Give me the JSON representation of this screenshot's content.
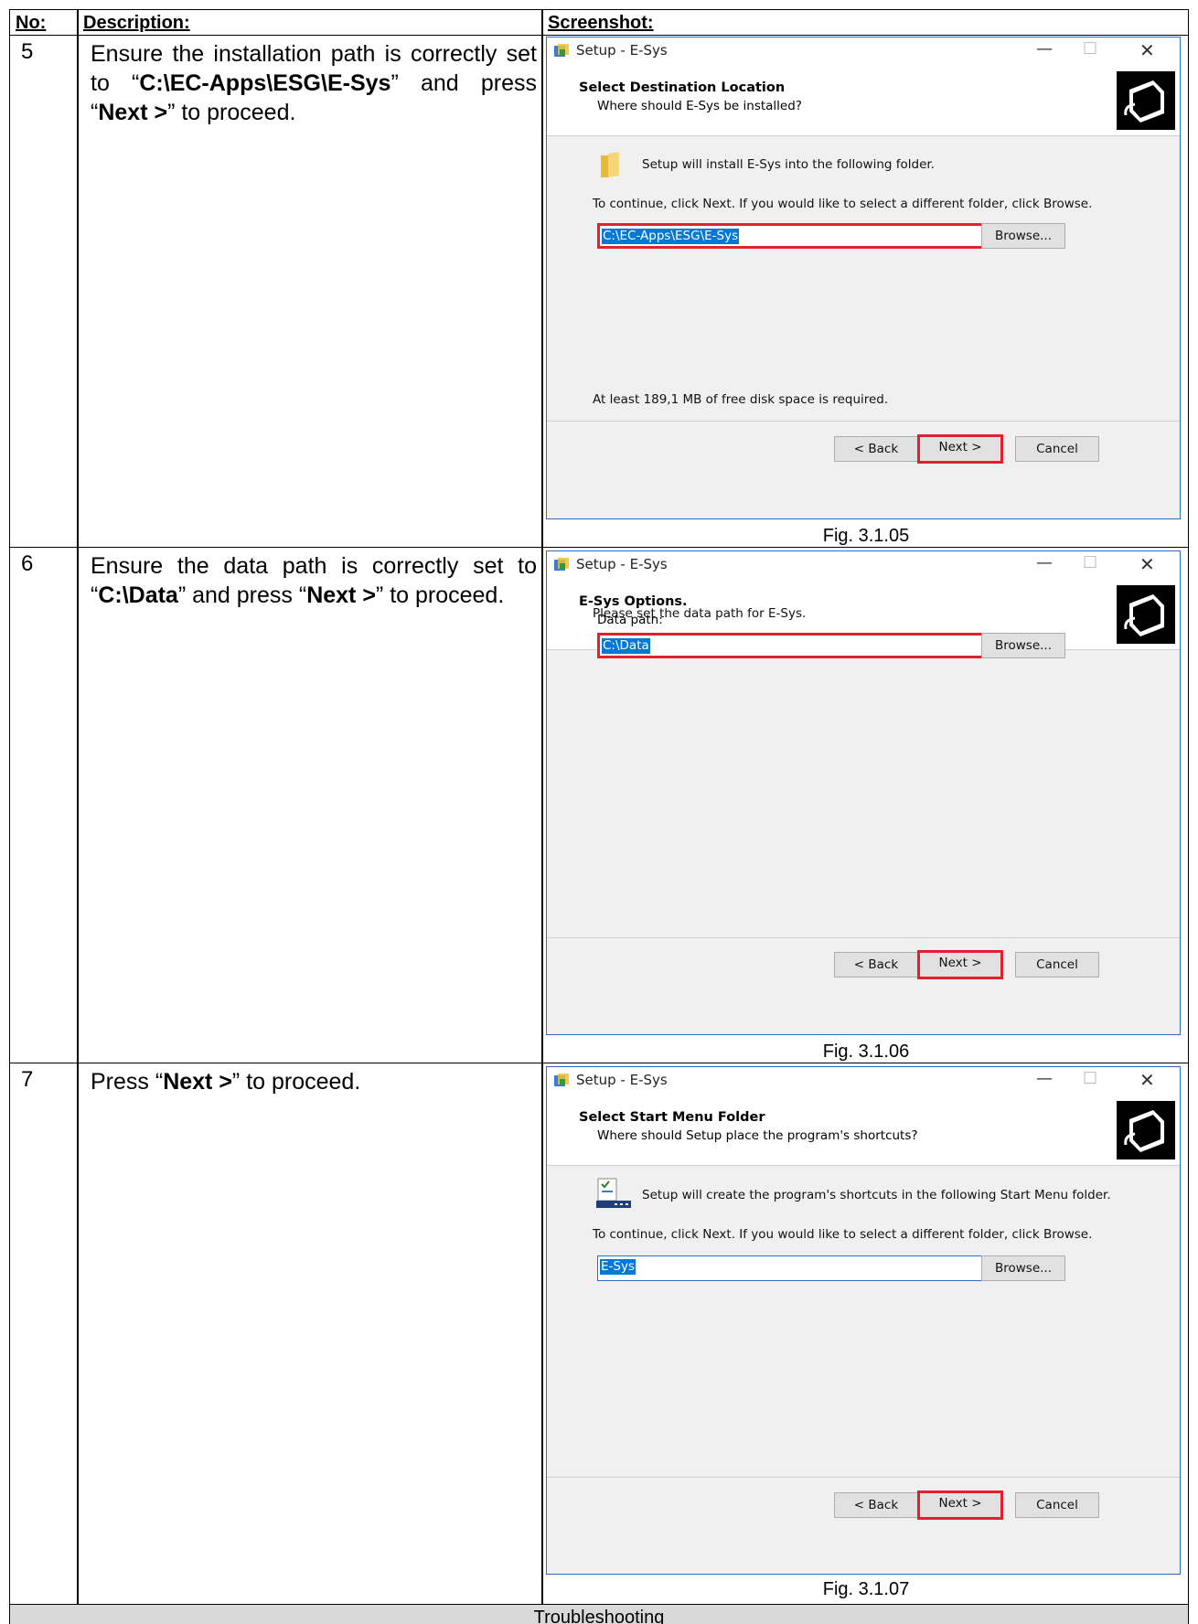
{
  "headers": {
    "no": "No:",
    "desc": "Description:",
    "shot": "Screenshot:"
  },
  "rows": [
    {
      "num": "5",
      "desc_parts": [
        "Ensure the installation path is correctly set to “",
        "C:\\EC-Apps\\ESG\\E-Sys",
        "” and press “",
        "Next >",
        "” to proceed."
      ],
      "figure": "Fig. 3.1.05",
      "dialog": {
        "title": "Setup - E-Sys",
        "heading": "Select Destination Location",
        "subheading": "Where should E-Sys be installed?",
        "line1": "Setup will install E-Sys into the following folder.",
        "line2": "To continue, click Next. If you would like to select a different folder, click Browse.",
        "path": "C:\\EC-Apps\\ESG\\E-Sys",
        "browse": "Browse...",
        "space": "At least 189,1 MB of free disk space is required.",
        "back": "< Back",
        "next": "Next >",
        "cancel": "Cancel"
      }
    },
    {
      "num": "6",
      "desc_parts": [
        "Ensure the data path is correctly set to “",
        "C:\\Data",
        "” and press “",
        "Next >",
        "” to proceed."
      ],
      "figure": "Fig. 3.1.06",
      "dialog": {
        "title": "Setup - E-Sys",
        "heading": "E-Sys Options.",
        "subheading": "Data path:",
        "line1": "Please set the data path for E-Sys.",
        "path": "C:\\Data",
        "browse": "Browse...",
        "back": "< Back",
        "next": "Next >",
        "cancel": "Cancel"
      }
    },
    {
      "num": "7",
      "desc_parts": [
        "Press “",
        "Next >",
        "” to proceed."
      ],
      "figure": "Fig. 3.1.07",
      "dialog": {
        "title": "Setup - E-Sys",
        "heading": "Select Start Menu Folder",
        "subheading": "Where should Setup place the program's shortcuts?",
        "line1": "Setup will create the program's shortcuts in the following Start Menu folder.",
        "line2": "To continue, click Next. If you would like to select a different folder, click Browse.",
        "path": "E-Sys",
        "browse": "Browse...",
        "back": "< Back",
        "next": "Next >",
        "cancel": "Cancel"
      }
    }
  ],
  "footer": "Troubleshooting",
  "window_controls": {
    "min": "—",
    "max": "☐",
    "close": "✕"
  },
  "colors": {
    "highlight_red": "#e3202b",
    "selection_blue": "#0078d7",
    "dialog_bg": "#f0f0f0"
  }
}
